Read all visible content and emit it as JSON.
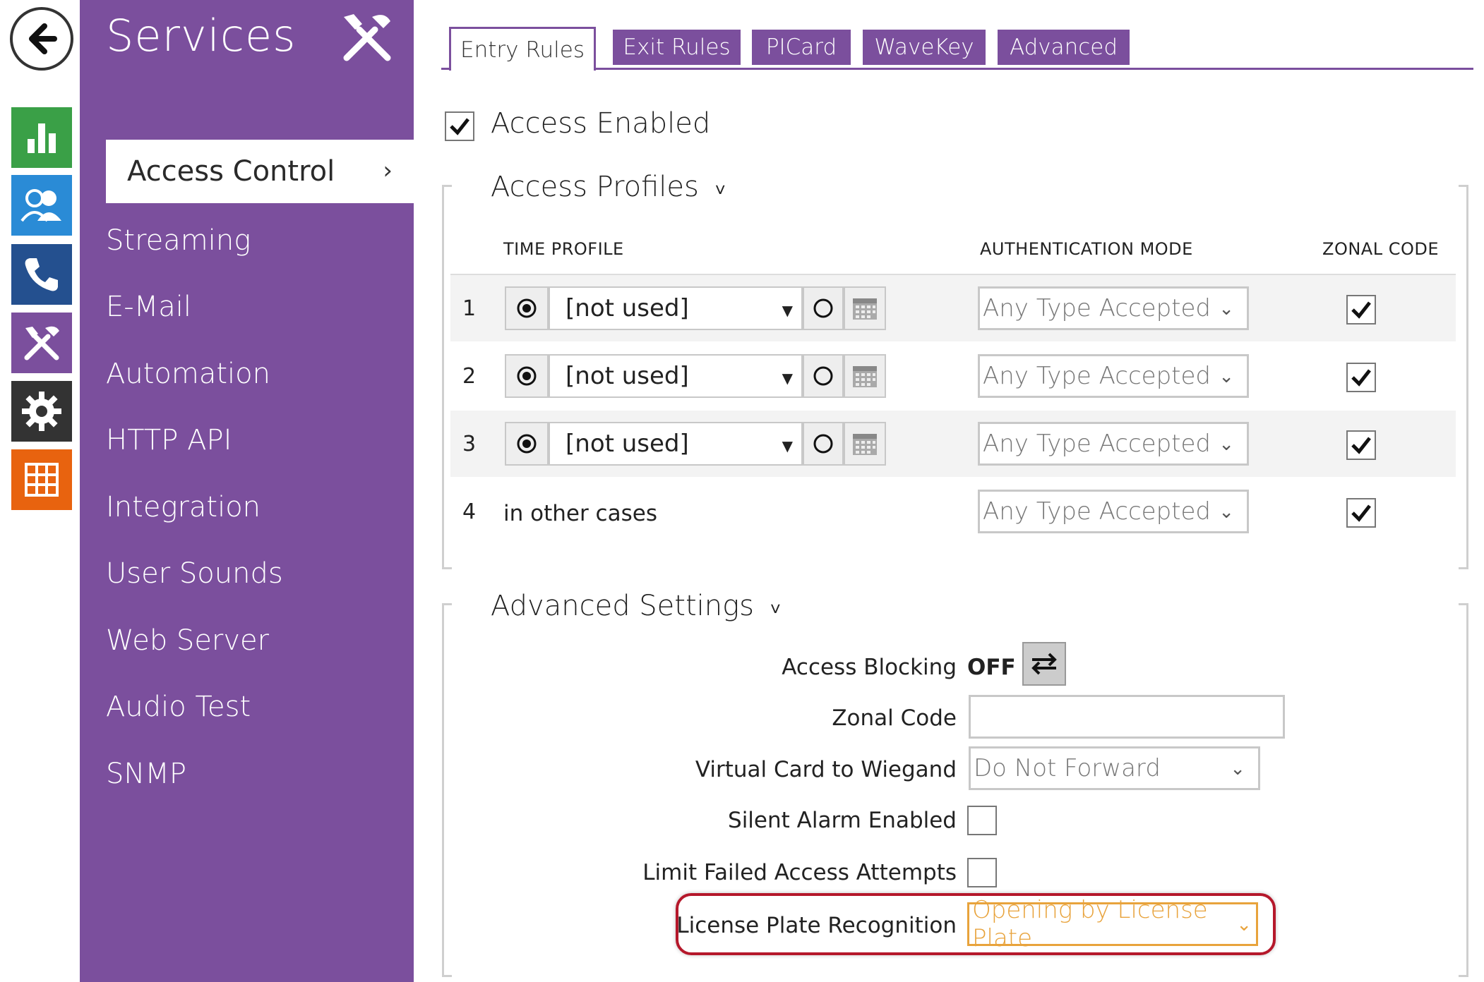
{
  "colors": {
    "purple": "#7b4f9d",
    "accent_orange": "#e8a33c",
    "highlight_red": "#b5182b"
  },
  "rail": {
    "icons": [
      "back-arrow-icon",
      "status-chart-icon",
      "directory-users-icon",
      "phone-icon",
      "services-tools-icon",
      "settings-gear-icon",
      "system-grid-icon"
    ]
  },
  "sidebar": {
    "title": "Services",
    "active_item": "Access Control",
    "active_chevron": "›",
    "items": [
      "Streaming",
      "E-Mail",
      "Automation",
      "HTTP API",
      "Integration",
      "User Sounds",
      "Web Server",
      "Audio Test",
      "SNMP"
    ]
  },
  "tabs": [
    "Entry Rules",
    "Exit Rules",
    "PICard",
    "WaveKey",
    "Advanced"
  ],
  "access_enabled": {
    "label": "Access Enabled",
    "checked": true
  },
  "access_profiles": {
    "title": "Access Profiles",
    "chevron": "˅",
    "headers": {
      "time_profile": "TIME PROFILE",
      "auth_mode": "AUTHENTICATION MODE",
      "zonal_code": "ZONAL CODE"
    },
    "rows": [
      {
        "num": "1",
        "time_profile": "[not used]",
        "auth_mode": "Any Type Accepted",
        "zonal": true
      },
      {
        "num": "2",
        "time_profile": "[not used]",
        "auth_mode": "Any Type Accepted",
        "zonal": true
      },
      {
        "num": "3",
        "time_profile": "[not used]",
        "auth_mode": "Any Type Accepted",
        "zonal": true
      },
      {
        "num": "4",
        "time_profile": "in other cases",
        "auth_mode": "Any Type Accepted",
        "zonal": true
      }
    ]
  },
  "advanced": {
    "title": "Advanced Settings",
    "chevron": "˅",
    "access_blocking": {
      "label": "Access Blocking",
      "value": "OFF"
    },
    "zonal_code": {
      "label": "Zonal Code",
      "value": ""
    },
    "virtual_card": {
      "label": "Virtual Card to Wiegand",
      "value": "Do Not Forward"
    },
    "silent_alarm": {
      "label": "Silent Alarm Enabled",
      "checked": false
    },
    "limit_failed": {
      "label": "Limit Failed Access Attempts",
      "checked": false
    },
    "license_plate": {
      "label": "License Plate Recognition",
      "value": "Opening by License Plate"
    }
  }
}
